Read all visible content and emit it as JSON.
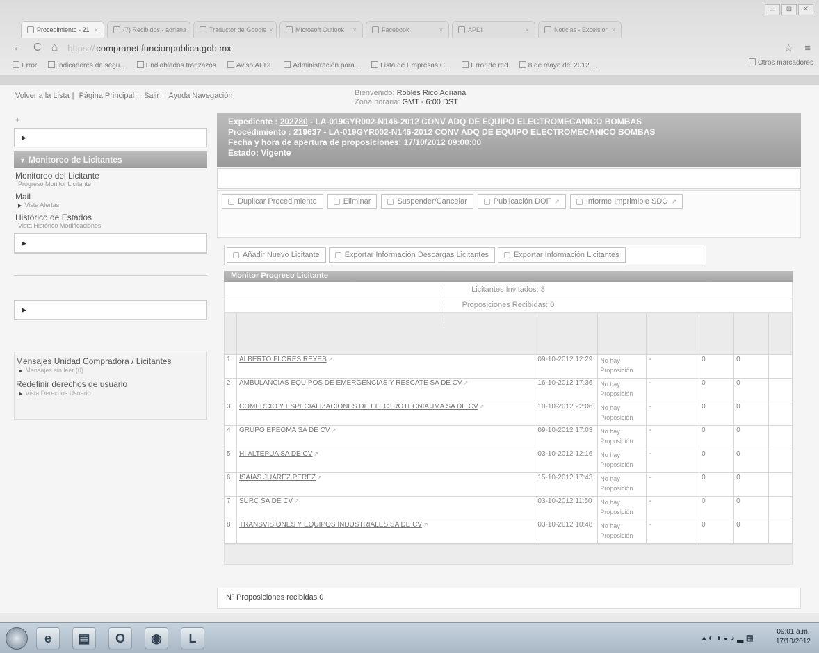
{
  "browser": {
    "tabs": [
      {
        "label": "Procedimiento - 21",
        "active": true
      },
      {
        "label": "(7) Recibidos - adriana",
        "active": false
      },
      {
        "label": "Traductor de Google",
        "active": false
      },
      {
        "label": "Microsoft Outlook",
        "active": false
      },
      {
        "label": "Facebook",
        "active": false
      },
      {
        "label": "APDI",
        "active": false
      },
      {
        "label": "Noticias - Excelsior",
        "active": false
      }
    ],
    "window_buttons": [
      "▭",
      "⊡",
      "✕"
    ],
    "url_scheme": "https://",
    "url_host": "compranet.funcionpublica.gob.mx",
    "bookmarks": [
      "Error",
      "Indicadores de segu...",
      "Endiablados tranzazos",
      "Aviso APDL",
      "Administración para...",
      "Lista de Empresas C...",
      "Error de red",
      "8 de mayo del 2012 ..."
    ],
    "other_bookmarks": "Otros marcadores"
  },
  "top": {
    "links": [
      "Volver a la Lista",
      "Página Principal",
      "Salir",
      "Ayuda Navegación"
    ],
    "welcome_label": "Bienvenido:",
    "welcome_name": "Robles Rico Adriana",
    "zone_label": "Zona horaria:",
    "zone_value": "GMT - 6:00 DST"
  },
  "sidebar": {
    "plus": "+",
    "section_title": "Monitoreo de Licitantes",
    "items": [
      {
        "title": "Monitoreo del Licitante",
        "sub": "Progreso Monitor Licitante"
      },
      {
        "title": "Mail",
        "sub": "Vista Alertas"
      },
      {
        "title": "Histórico de Estados",
        "sub": "Vista Histórico Modificaciones"
      }
    ],
    "bottom_items": [
      {
        "title": "Mensajes Unidad Compradora / Licitantes",
        "sub": "Mensajes sin leer (0)"
      },
      {
        "title": "Redefinir derechos de usuario",
        "sub": "Vista Derechos Usuario"
      }
    ]
  },
  "banner": {
    "line1_prefix": "Expediente : ",
    "expediente": "202780",
    "line1_suffix": " - LA-019GYR002-N146-2012 CONV ADQ DE EQUIPO ELECTROMECANICO BOMBAS",
    "line2": "Procedimiento : 219637 - LA-019GYR002-N146-2012 CONV ADQ DE EQUIPO ELECTROMECANICO BOMBAS",
    "line3": "Fecha y hora de apertura de proposiciones: 17/10/2012 09:00:00",
    "line4": "Estado: Vigente"
  },
  "actions": [
    "Duplicar Procedimiento",
    "Eliminar",
    "Suspender/Cancelar",
    "Publicación DOF",
    "Informe Imprimible SDO"
  ],
  "actions2": [
    "Añadir Nuevo Licitante",
    "Exportar Información Descargas Licitantes",
    "Exportar Información Licitantes"
  ],
  "monitor": {
    "title": "Monitor Progreso Licitante",
    "invitados": "Licitantes Invitados: 8",
    "recibidas": "Proposiciones Recibidas: 0",
    "rows": [
      {
        "n": "1",
        "name": "ALBERTO FLORES REYES",
        "date": "09-10-2012 12:29",
        "status": "No hay Proposición",
        "d1": "-",
        "c1": "0",
        "c2": "0"
      },
      {
        "n": "2",
        "name": "AMBULANCIAS EQUIPOS DE EMERGENCIAS Y RESCATE SA DE CV",
        "date": "16-10-2012 17:36",
        "status": "No hay Proposición",
        "d1": "-",
        "c1": "0",
        "c2": "0"
      },
      {
        "n": "3",
        "name": "COMERCIO Y ESPECIALIZACIONES DE ELECTROTECNIA JMA SA DE CV",
        "date": "10-10-2012 22:06",
        "status": "No hay Proposición",
        "d1": "-",
        "c1": "0",
        "c2": "0"
      },
      {
        "n": "4",
        "name": "GRUPO EPEGMA SA DE CV",
        "date": "09-10-2012 17:03",
        "status": "No hay Proposición",
        "d1": "-",
        "c1": "0",
        "c2": "0"
      },
      {
        "n": "5",
        "name": "HI ALTEPUA SA DE CV",
        "date": "03-10-2012 12:16",
        "status": "No hay Proposición",
        "d1": "-",
        "c1": "0",
        "c2": "0"
      },
      {
        "n": "6",
        "name": "ISAIAS JUAREZ PEREZ",
        "date": "15-10-2012 17:43",
        "status": "No hay Proposición",
        "d1": "-",
        "c1": "0",
        "c2": "0"
      },
      {
        "n": "7",
        "name": "SURC SA DE CV",
        "date": "03-10-2012 11:50",
        "status": "No hay Proposición",
        "d1": "-",
        "c1": "0",
        "c2": "0"
      },
      {
        "n": "8",
        "name": "TRANSVISIONES Y EQUIPOS INDUSTRIALES SA DE CV",
        "date": "03-10-2012 10:48",
        "status": "No hay Proposición",
        "d1": "-",
        "c1": "0",
        "c2": "0"
      }
    ]
  },
  "footer": "Nº Proposiciones recibidas 0",
  "taskbar": {
    "time": "09:01 a.m.",
    "date": "17/10/2012"
  }
}
